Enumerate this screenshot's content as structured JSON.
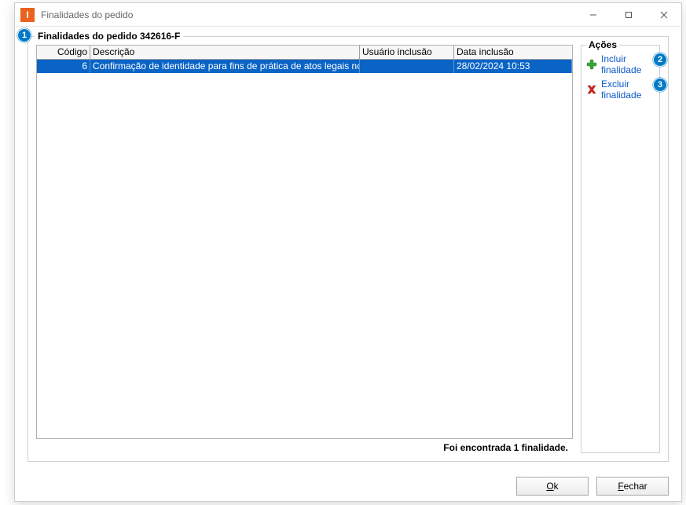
{
  "window": {
    "title": "Finalidades do pedido",
    "iconLetter": "I"
  },
  "group": {
    "title": "Finalidades do pedido 342616-F"
  },
  "grid": {
    "columns": {
      "codigo": "Código",
      "descricao": "Descrição",
      "usuario": "Usuário inclusão",
      "data": "Data inclusão"
    },
    "rows": [
      {
        "codigo": "6",
        "descricao": "Confirmação de identidade para fins de prática de atos legais no intere",
        "usuario": "",
        "data": "28/02/2024 10:53"
      }
    ],
    "status": "Foi encontrada 1 finalidade."
  },
  "actions": {
    "title": "Ações",
    "incluir": "Incluir finalidade",
    "excluir": "Excluir finalidade"
  },
  "buttons": {
    "ok": "Ok",
    "fechar": "Fechar",
    "ok_u": "O",
    "ok_rest": "k",
    "fechar_u": "F",
    "fechar_rest": "echar"
  },
  "badges": {
    "b1": "1",
    "b2": "2",
    "b3": "3"
  }
}
